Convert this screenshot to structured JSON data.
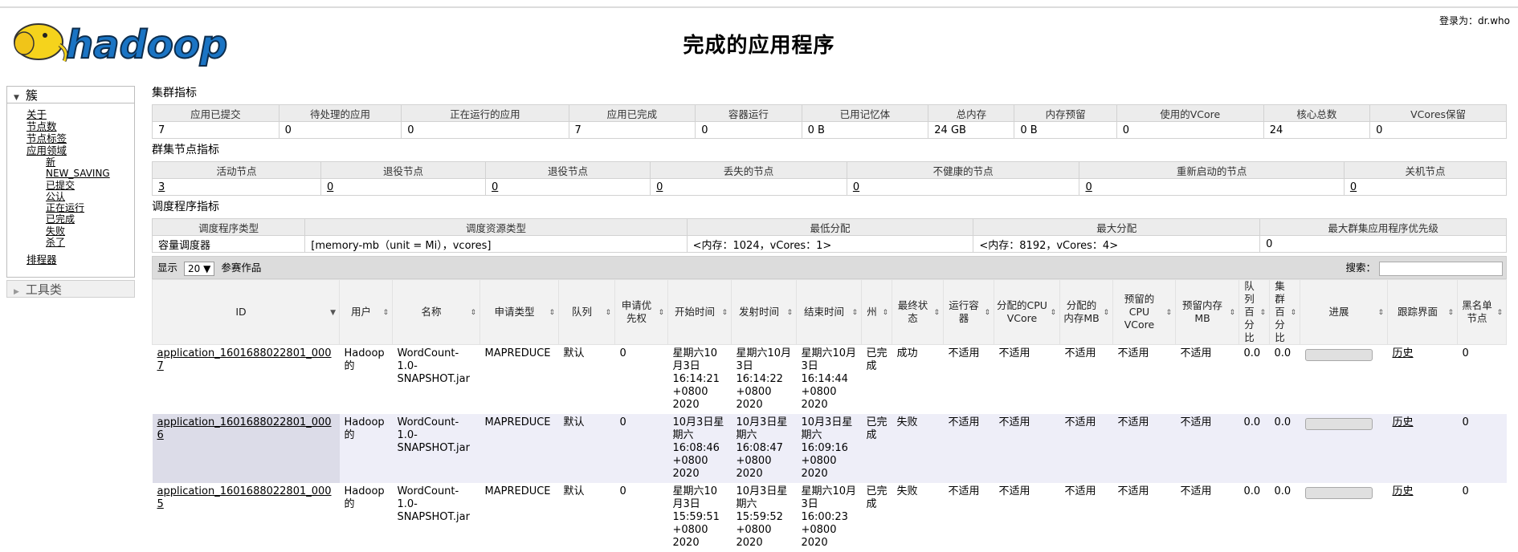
{
  "header": {
    "title": "完成的应用程序",
    "login": "登录为：dr.who",
    "logo_text": "hadoop"
  },
  "sidebar": {
    "cluster_title": "簇",
    "links": [
      {
        "label": "关于",
        "level": 1
      },
      {
        "label": "节点数",
        "level": 1
      },
      {
        "label": "节点标签",
        "level": 1
      },
      {
        "label": "应用领域",
        "level": 1
      },
      {
        "label": "新",
        "level": 2
      },
      {
        "label": "NEW_SAVING",
        "level": 2
      },
      {
        "label": "已提交",
        "level": 2
      },
      {
        "label": "公认",
        "level": 2
      },
      {
        "label": "正在运行",
        "level": 2
      },
      {
        "label": "已完成",
        "level": 2
      },
      {
        "label": "失败",
        "level": 2
      },
      {
        "label": "杀了",
        "level": 2
      }
    ],
    "scheduler_link": "排程器",
    "tools_title": "工具类"
  },
  "cluster_metrics": {
    "title": "集群指标",
    "headers": [
      "应用已提交",
      "待处理的应用",
      "正在运行的应用",
      "应用已完成",
      "容器运行",
      "已用记忆体",
      "总内存",
      "内存预留",
      "使用的VCore",
      "核心总数",
      "VCores保留"
    ],
    "values": [
      "7",
      "0",
      "0",
      "7",
      "0",
      "0 B",
      "24 GB",
      "0 B",
      "0",
      "24",
      "0"
    ]
  },
  "node_metrics": {
    "title": "群集节点指标",
    "headers": [
      "活动节点",
      "退役节点",
      "退役节点",
      "丢失的节点",
      "不健康的节点",
      "重新启动的节点",
      "关机节点"
    ],
    "values": [
      "3",
      "0",
      "0",
      "0",
      "0",
      "0",
      "0"
    ]
  },
  "scheduler_metrics": {
    "title": "调度程序指标",
    "headers": [
      "调度程序类型",
      "调度资源类型",
      "最低分配",
      "最大分配",
      "最大群集应用程序优先级"
    ],
    "values": [
      "容量调度器",
      "[memory-mb（unit = Mi），vcores]",
      "<内存：1024，vCores：1>",
      "<内存：8192，vCores：4>",
      "0"
    ]
  },
  "apps": {
    "show_label": "显示",
    "page_size": "20",
    "entries_label": "参赛作品",
    "search_label": "搜索：",
    "columns": [
      "ID",
      "用户",
      "名称",
      "申请类型",
      "队列",
      "申请优先权",
      "开始时间",
      "发射时间",
      "结束时间",
      "州",
      "最终状态",
      "运行容器",
      "分配的CPU VCore",
      "分配的内存MB",
      "预留的CPU VCore",
      "预留内存MB",
      "队列百分比",
      "集群百分比",
      "进展",
      "跟踪界面",
      "黑名单节点"
    ],
    "rows": [
      {
        "id": "application_1601688022801_0007",
        "user": "Hadoop的",
        "name": "WordCount-1.0-SNAPSHOT.jar",
        "type": "MAPREDUCE",
        "queue": "默认",
        "priority": "0",
        "start": "星期六10月3日16:14:21 +0800 2020",
        "launch": "星期六10月3日16:14:22 +0800 2020",
        "finish": "星期六10月3日16:14:44 +0800 2020",
        "state": "已完成",
        "final": "成功",
        "containers": "不适用",
        "cpu": "不适用",
        "mem": "不适用",
        "rcpu": "不适用",
        "rmem": "不适用",
        "qpct": "0.0",
        "cpct": "0.0",
        "progress": 0,
        "track": "历史",
        "blacklist": "0"
      },
      {
        "id": "application_1601688022801_0006",
        "user": "Hadoop的",
        "name": "WordCount-1.0-SNAPSHOT.jar",
        "type": "MAPREDUCE",
        "queue": "默认",
        "priority": "0",
        "start": "10月3日星期六16:08:46 +0800 2020",
        "launch": "10月3日星期六16:08:47 +0800 2020",
        "finish": "10月3日星期六16:09:16 +0800 2020",
        "state": "已完成",
        "final": "失败",
        "containers": "不适用",
        "cpu": "不适用",
        "mem": "不适用",
        "rcpu": "不适用",
        "rmem": "不适用",
        "qpct": "0.0",
        "cpct": "0.0",
        "progress": 0,
        "track": "历史",
        "blacklist": "0"
      },
      {
        "id": "application_1601688022801_0005",
        "user": "Hadoop的",
        "name": "WordCount-1.0-SNAPSHOT.jar",
        "type": "MAPREDUCE",
        "queue": "默认",
        "priority": "0",
        "start": "星期六10月3日15:59:51 +0800 2020",
        "launch": "10月3日星期六15:59:52 +0800 2020",
        "finish": "星期六10月3日16:00:23 +0800 2020",
        "state": "已完成",
        "final": "失败",
        "containers": "不适用",
        "cpu": "不适用",
        "mem": "不适用",
        "rcpu": "不适用",
        "rmem": "不适用",
        "qpct": "0.0",
        "cpct": "0.0",
        "progress": 0,
        "track": "历史",
        "blacklist": "0"
      }
    ]
  }
}
